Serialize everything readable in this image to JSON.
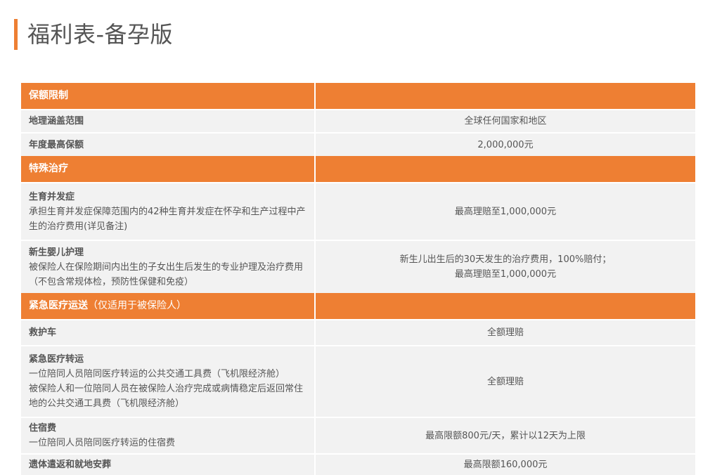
{
  "title": "福利表-备孕版",
  "colors": {
    "accent": "#ee7f33",
    "row_bg": "#f2f2f2",
    "text": "#555555"
  },
  "sections": {
    "coverage_limit": {
      "label": "保额限制",
      "items": [
        {
          "name": "地理涵盖范围",
          "value": "全球任何国家和地区"
        },
        {
          "name": "年度最高保额",
          "value": "2,000,000元"
        }
      ]
    },
    "special_treatment": {
      "label": "特殊治疗",
      "items": [
        {
          "name": "生育并发症",
          "desc": "承担生育并发症保障范围内的42种生育并发症在怀孕和生产过程中产生的治疗费用(详见备注)",
          "value": "最高理赔至1,000,000元"
        },
        {
          "name": "新生婴儿护理",
          "desc": "被保险人在保险期间内出生的子女出生后发生的专业护理及治疗费用（不包含常规体检，预防性保健和免疫）",
          "value_line1": "新生儿出生后的30天发生的治疗费用，100%赔付；",
          "value_line2": "最高理赔至1,000,000元"
        }
      ]
    },
    "emergency_transport": {
      "label": "紧急医疗运送",
      "note": "（仅适用于被保险人）",
      "items": [
        {
          "name": "救护车",
          "value": "全额理赔"
        },
        {
          "name": "紧急医疗转运",
          "desc_line1": "一位陪同人员陪同医疗转运的公共交通工具费（飞机限经济舱）",
          "desc_line2": "被保险人和一位陪同人员在被保险人治疗完成或病情稳定后返回常住地的公共交通工具费（飞机限经济舱）",
          "value": "全额理赔"
        },
        {
          "name": "住宿费",
          "desc": "一位陪同人员陪同医疗转运的住宿费",
          "value": "最高限额800元/天，累计以12天为上限"
        },
        {
          "name": "遗体遣返和就地安葬",
          "value": "最高限额160,000元"
        }
      ]
    }
  }
}
